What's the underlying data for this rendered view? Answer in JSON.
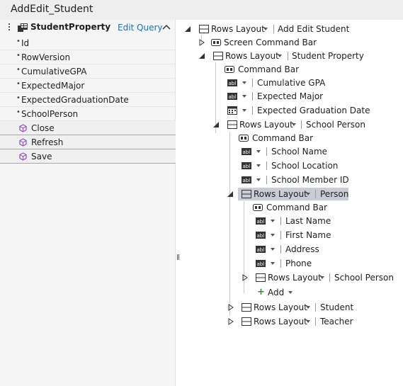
{
  "window": {
    "title": "AddEdit_Student"
  },
  "left_pane": {
    "entity_name": "StudentProperty",
    "edit_query_label": "Edit Query",
    "properties": [
      "Id",
      "RowVersion",
      "CumulativeGPA",
      "ExpectedMajor",
      "ExpectedGraduationDate",
      "SchoolPerson"
    ],
    "methods": [
      "Close",
      "Refresh",
      "Save"
    ]
  },
  "tree": {
    "root": {
      "control": "Rows Layout",
      "name": "Add Edit Student"
    },
    "screen_command_bar": "Screen Command Bar",
    "student_property": {
      "control": "Rows Layout",
      "name": "Student Property"
    },
    "command_bar": "Command Bar",
    "cumulative_gpa": "Cumulative GPA",
    "expected_major": "Expected Major",
    "expected_graduation_date": "Expected Graduation Date",
    "school_person": {
      "control": "Rows Layout",
      "name": "School Person"
    },
    "school_name": "School Name",
    "school_location": "School Location",
    "school_member_id": "School Member ID",
    "person": {
      "control": "Rows Layout",
      "name": "Person"
    },
    "last_name": "Last Name",
    "first_name": "First Name",
    "address": "Address",
    "phone": "Phone",
    "nested_school_person": {
      "control": "Rows Layout",
      "name": "School Person"
    },
    "add_label": "Add",
    "student": {
      "control": "Rows Layout",
      "name": "Student"
    },
    "teacher": {
      "control": "Rows Layout",
      "name": "Teacher"
    }
  }
}
